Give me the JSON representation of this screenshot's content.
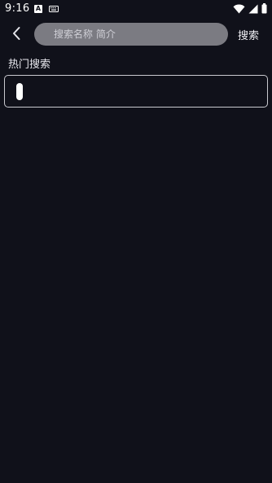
{
  "status_bar": {
    "time": "9:16",
    "icons": [
      "app-a-icon",
      "keyboard-icon",
      "wifi-icon",
      "signal-icon",
      "battery-icon"
    ],
    "app_icon_letter": "A"
  },
  "top_bar": {
    "back_icon": "chevron-left-icon",
    "search": {
      "placeholder": "搜索名称 简介",
      "value": ""
    },
    "search_label": "搜索"
  },
  "hot_search": {
    "title": "热门搜索",
    "items": [
      ""
    ]
  },
  "colors": {
    "background": "#10111a",
    "search_field": "#7b7b82",
    "text": "#e9e9ef",
    "box_border": "#c9c9cf"
  }
}
